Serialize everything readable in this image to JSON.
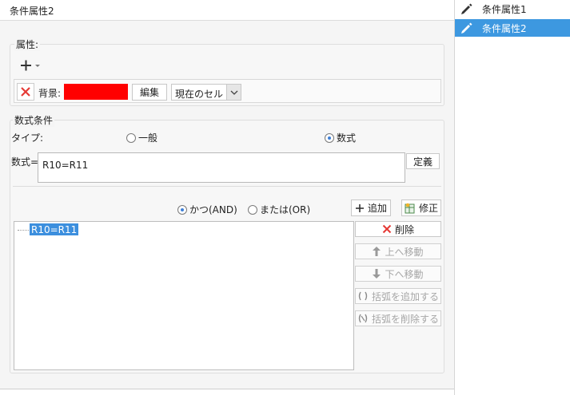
{
  "title": "条件属性2",
  "attributes": {
    "label": "属性:",
    "background_label": "背景:",
    "background_color": "#ff0000",
    "edit_button": "編集",
    "scope_value": "現在のセル"
  },
  "formula_conditions": {
    "label": "数式条件",
    "type_label": "タイプ:",
    "type_option_general": "一般",
    "type_option_formula": "数式",
    "selected_type": "数式",
    "formula_label": "数式=",
    "formula_value": "R10=R11",
    "define_button": "定義",
    "logic_and": "かつ(AND)",
    "logic_or": "または(OR)",
    "selected_logic": "かつ(AND)",
    "add_button": "追加",
    "modify_button": "修正",
    "delete_button": "削除",
    "move_up_button": "上へ移動",
    "move_down_button": "下へ移動",
    "add_parens_button": "括弧を追加する",
    "remove_parens_button": "括弧を削除する",
    "condition_items": [
      "R10=R11"
    ]
  },
  "sidebar": {
    "items": [
      {
        "label": "条件属性1",
        "selected": false
      },
      {
        "label": "条件属性2",
        "selected": true
      }
    ]
  },
  "colors": {
    "selection_blue": "#3d98e0",
    "highlight_blue": "#3c8fde",
    "delete_red": "#e53935"
  }
}
